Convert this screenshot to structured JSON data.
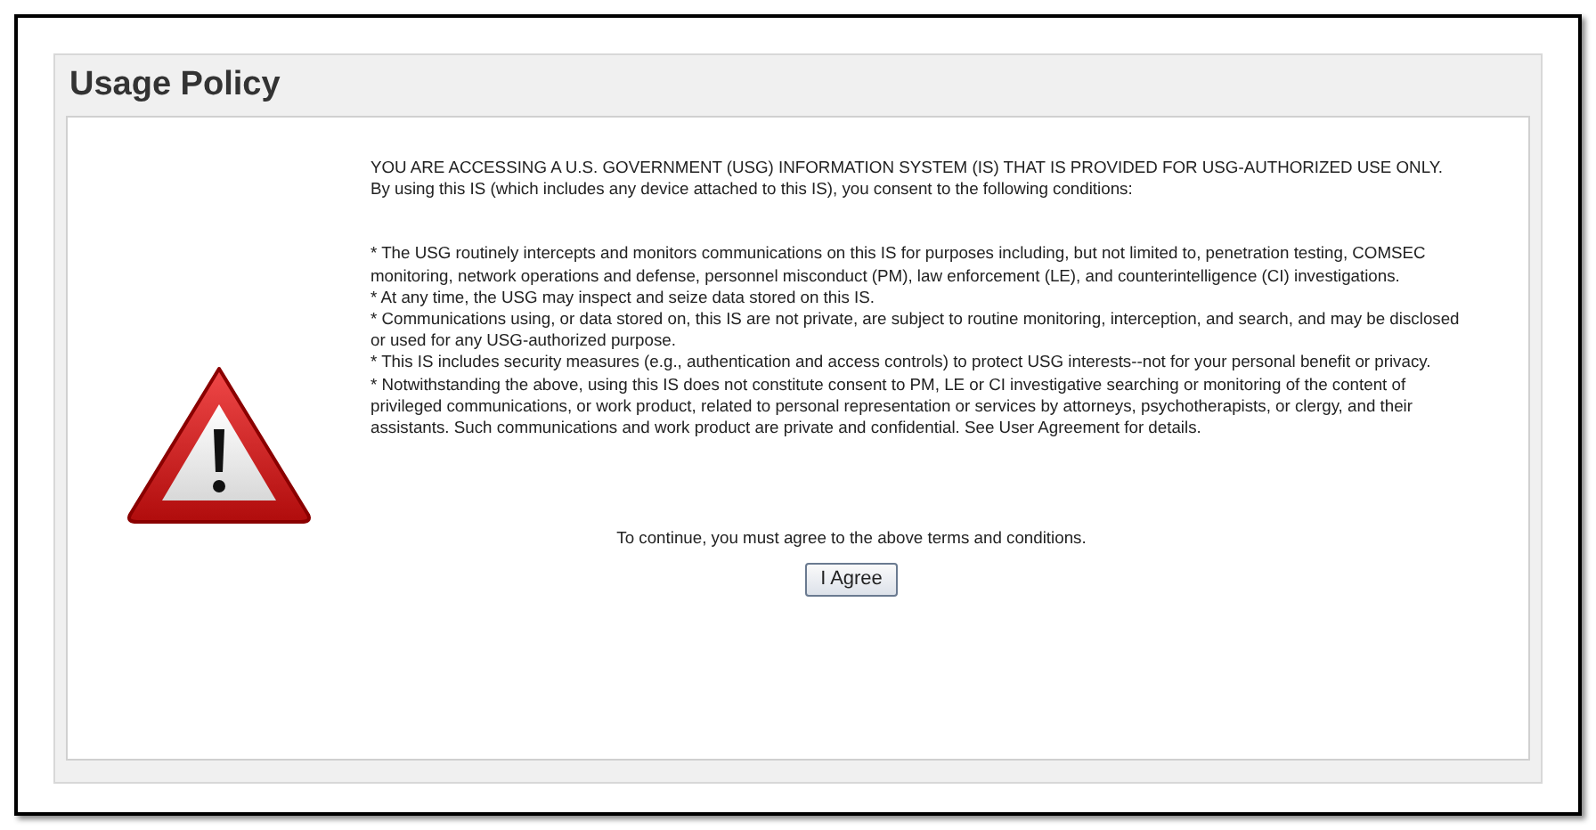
{
  "panel": {
    "title": "Usage Policy"
  },
  "intro": [
    "YOU ARE ACCESSING A U.S. GOVERNMENT (USG) INFORMATION SYSTEM (IS) THAT IS PROVIDED FOR USG-AUTHORIZED USE ONLY.",
    "By using this IS (which includes any device attached to this IS), you consent to the following conditions:"
  ],
  "conditions": [
    "* The USG routinely intercepts and monitors communications on this IS for purposes including, but not limited to, penetration testing, COMSEC monitoring, network operations and defense, personnel misconduct (PM), law enforcement (LE), and counterintelligence (CI) investigations.",
    "* At any time, the USG may inspect and seize data stored on this IS.",
    "* Communications using, or data stored on, this IS are not private, are subject to routine monitoring, interception, and search, and may be disclosed or used for any USG-authorized purpose.",
    "* This IS includes security measures (e.g., authentication and access controls) to protect USG interests--not for your personal benefit or privacy.",
    "* Notwithstanding the above, using this IS does not constitute consent to PM, LE or CI investigative searching or monitoring of the content of privileged communications, or work product, related to personal representation or services by attorneys, psychotherapists, or clergy, and their assistants. Such communications and work product are private and confidential. See User Agreement for details."
  ],
  "prompt": "To continue, you must agree to the above terms and conditions.",
  "agree_button": "I Agree"
}
